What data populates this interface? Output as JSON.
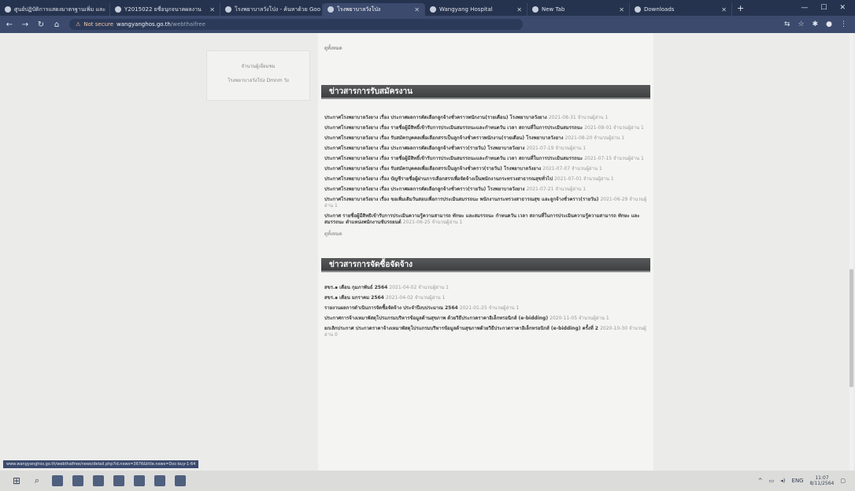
{
  "browser": {
    "tabs": [
      {
        "title": "ศูนย์ปฏิบัติการแสดงมาตรฐานเพิ่ม และ"
      },
      {
        "title": "Y2015022 ยชื่อนุกจนาคผลงาน"
      },
      {
        "title": "โรงพยาบาลวังโป่ง - ค้นหาด้วย Goo"
      },
      {
        "title": "โรงพยาบาลวังโป่ง",
        "active": true
      },
      {
        "title": "Wangyang Hospital"
      },
      {
        "title": "New Tab"
      },
      {
        "title": "Downloads"
      }
    ],
    "new_tab_icon": "+",
    "address": {
      "warning": "Not secure",
      "host": "wangyanghos.go.th",
      "path": "/webthaifree"
    }
  },
  "sidebar": {
    "line1": "จำนวนผู้เยี่ยมชม",
    "line2": "โรงพยาบาลวังโป่ง Dmnm วัง"
  },
  "top_snippet": {
    "more": "ดูทั้งหมด"
  },
  "section_jobs": {
    "title": "ข่าวสารการรับสมัครงาน",
    "items": [
      {
        "text": "ประกาศโรงพยาบาลวังยาง เรื่อง ประกาศผลการคัดเลือกลูกจ้างชั่วคราวพนักงาน(รายเดือน) โรงพยาบาลวังยาง",
        "meta": "2021-08-31 จำนวนผู้อ่าน 1"
      },
      {
        "text": "ประกาศโรงพยาบาลวังยาง เรื่อง รายชื่อผู้มีสิทธิ์เข้ารับการประเมินสมรรถนะและกำหนดวัน เวลา สถานที่ในการประเมินสมรรถนะ",
        "meta": "2021-08-01 จำนวนผู้อ่าน 1"
      },
      {
        "text": "ประกาศโรงพยาบาลวังยาง เรื่อง รับสมัครบุคคลเพื่อเลือกสรรเป็นลูกจ้างชั่วคราวพนักงาน(รายเดือน) โรงพยาบาลวังยาง",
        "meta": "2021-08-20 จำนวนผู้อ่าน 1"
      },
      {
        "text": "ประกาศโรงพยาบาลวังยาง เรื่อง ประกาศผลการคัดเลือกลูกจ้างชั่วคราว(รายวัน) โรงพยาบาลวังยาง",
        "meta": "2021-07-19 จำนวนผู้อ่าน 1"
      },
      {
        "text": "ประกาศโรงพยาบาลวังยาง เรื่อง รายชื่อผู้มีสิทธิ์เข้ารับการประเมินสมรรถนะและกำหนดวัน เวลา สถานที่ในการประเมินสมรรถนะ",
        "meta": "2021-07-15 จำนวนผู้อ่าน 1"
      },
      {
        "text": "ประกาศโรงพยาบาลวังยาง เรื่อง รับสมัครบุคคลเพื่อเลือกสรรเป็นลูกจ้างชั่วคราว(รายวัน) โรงพยาบาลวังยาง",
        "meta": "2021-07-07 จำนวนผู้อ่าน 1"
      },
      {
        "text": "ประกาศโรงพยาบาลวังยาง เรื่อง บัญชีรายชื่อผู้ผ่านการเลือกสรรเพื่อจัดจ้างเป็นพนักงานกระทรวงสาธารณสุขทั่วไป",
        "meta": "2021-07-01 จำนวนผู้อ่าน 1"
      },
      {
        "text": "ประกาศโรงพยาบาลวังยาง เรื่อง ประกาศผลการคัดเลือกลูกจ้างชั่วคราว(รายวัน) โรงพยาบาลวังยาง",
        "meta": "2021-07-21 จำนวนผู้อ่าน 1"
      },
      {
        "text": "ประกาศโรงพยาบาลวังยาง เรื่อง ขอเพิ่มเติมวันสอบเพื่อการประเมินสมรรถนะ พนักงานกระทรวงสาธารณสุข และลูกจ้างชั่วคราว(รายวัน)",
        "meta": "2021-06-29 จำนวนผู้อ่าน 1"
      },
      {
        "text": "ประกาศ รายชื่อผู้มีสิทธิเข้ารับการประเมินความรู้ความสามารถ ทักษะ และสมรรถนะ กำหนดวัน เวลา สถานที่ในการประเมินความรู้ความสามารถ ทักษะ และสมรรถนะ ตำแหน่งพนักงานขับรถยนต์",
        "meta": "2021-06-25 จำนวนผู้อ่าน 1"
      }
    ],
    "more": "ดูทั้งหมด"
  },
  "section_procure": {
    "title": "ข่าวสารการจัดซื้อจัดจ้าง",
    "items": [
      {
        "text": "สขร.๑ เดือน กุมภาพันธ์ 2564",
        "meta": "2021-04-02 จำนวนผู้อ่าน 1"
      },
      {
        "text": "สขร.๑ เดือน มกราคม 2564",
        "meta": "2021-04-02 จำนวนผู้อ่าน 1"
      },
      {
        "text": "รายงานผลการดำเนินการจัดซื้อจัดจ้าง ประจำปีงบประมาณ 2564",
        "meta": "2021-01-25 จำนวนผู้อ่าน 1"
      },
      {
        "text": "ประกาศการจ้างเหมาพัสดุโปรแกรมบริหารข้อมูลด้านสุขภาพ ด้วยวิธีประกวดราคาอิเล็กทรอนิกส์ (e-bidding)",
        "meta": "2020-11-05 จำนวนผู้อ่าน 1"
      },
      {
        "text": "ยกเลิกประกาศ ประกวดราคาจ้างเหมาพัสดุโปรแกรมบริหารข้อมูลด้านสุขภาพด้วยวิธีประกวดราคาอิเล็กทรอนิกส์ (e-bidding) ครั้งที่ 2",
        "meta": "2020-10-30 จำนวนผู้อ่าน 0"
      }
    ]
  },
  "status_url": "www.wangyanghos.go.th/webthaifree/news/detail.php?id.news=3676&title.news=Doc-buy-1-64",
  "taskbar": {
    "tray_text": "ENG",
    "time": "11:07",
    "date": "8/11/2564"
  }
}
